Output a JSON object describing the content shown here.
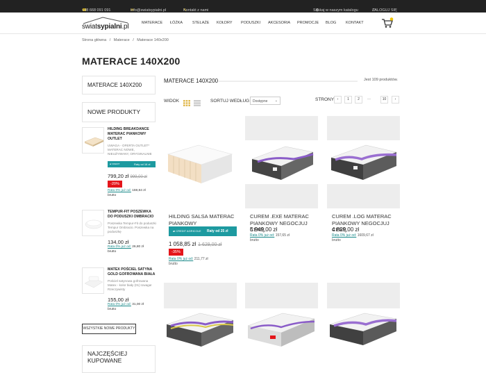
{
  "topbar": {
    "phone": "+48 668 091 091",
    "email": "info@swiatsypialni.pl",
    "contact": "Kontakt z nami",
    "search": "Szukaj w naszym katalogu",
    "login": "ZALOGUJ SIĘ"
  },
  "logo": {
    "part1": "swiat",
    "part2": "sypialni",
    "part3": ".pl"
  },
  "nav": [
    "MATERACE",
    "ŁÓŻKA",
    "STELAŻE",
    "KOŁDRY",
    "PODUSZKI",
    "AKCESORIA",
    "PROMOCJE",
    "BLOG",
    "KONTAKT"
  ],
  "breadcrumb": {
    "home": "Strona główna",
    "cat": "Materace",
    "current": "Materace 140x200",
    "sep": "/"
  },
  "page_title": "MATERACE 140X200",
  "sidebar": {
    "category_title": "MATERACE 140X200",
    "new_title": "NOWE PRODUKTY",
    "new_products": [
      {
        "name": "HILDING BREAKDANCE MATERAC PIANKOWY OUTLET",
        "desc": "UWAGA - OFERTA OUTLET* MATERAC NOWE, NIEUŻYWANY, ORYGINALNIE",
        "price": "799,20 zł",
        "old_price": "999,00 zł",
        "badge": "-20%",
        "banner": "Raty od 16 zł",
        "rata_link": "Rata 0% już od:",
        "rata_value": "159,84 zł",
        "rata_suffix": "brutto"
      },
      {
        "name": "TEMPUR-FIT POSZEWKA DO PODUSZKI OMBRACIO",
        "desc": "Poszewka Tempur-Fit do poduszki Tempur Ombracio. Poszewka na poduszkę",
        "price": "134,00 zł",
        "rata_link": "Rata 0% już od:",
        "rata_value": "26,80 zł",
        "rata_suffix": "brutto"
      },
      {
        "name": "MATEX POŚCIEL SATYNA GOLD GOFROWANA BIAŁA",
        "desc": "Pościel satynowa gofrowana Matex - kolor biały (01) Uwaga! Rzeczywisty",
        "price": "155,00 zł",
        "rata_link": "Rata 0% już od:",
        "rata_value": "31,00 zł",
        "rata_suffix": "brutto"
      }
    ],
    "all_new_button": "WSZYSTKIE NOWE PRODUKTY",
    "coupons_title": "NAJCZĘŚCIEJ KUPOWANE"
  },
  "main": {
    "title": "MATERACE 140X200",
    "count": "Jest 109 produktów.",
    "view_label": "WIDOK",
    "sort_label": "SORTUJ WEDŁUG",
    "sort_value": "Dostępne",
    "pages_label": "STRONY",
    "pages": [
      "‹",
      "1",
      "2",
      "…",
      "10",
      "›"
    ]
  },
  "products": [
    {
      "name": "HILDING SALSA MATERAC PIANKOWY",
      "price": "1 058,85 zł",
      "old_price": "1 629,00 zł",
      "badge": "-35%",
      "banner": "Raty od 25 zł",
      "rata_link": "Rata 0% już od:",
      "rata_value": "211,77 zł",
      "rata_suffix": "brutto"
    },
    {
      "name": "CUREM .EXE MATERAC PIANKOWY NEGOCJUJ CENĘ",
      "price": "5 949,00 zł",
      "rata_link": "Rata 0% już od:",
      "rata_value": "157,65 zł",
      "rata_suffix": "brutto"
    },
    {
      "name": "CUREM .LOG MATERAC PIANKOWY NEGOCJUJ CENĘ",
      "price": "4 829,00 zł",
      "rata_link": "Rata 0% już od:",
      "rata_value": "1609,67 zł",
      "rata_suffix": "brutto"
    }
  ],
  "colors": {
    "accent_teal": "#1d9aa0",
    "badge_red": "#e4161b",
    "topbar": "#222222",
    "icon_yellow": "#f0c400"
  },
  "icons": [
    "phone-icon",
    "mail-icon",
    "pencil-icon",
    "search-icon",
    "user-icon",
    "cart-icon",
    "grid-view-icon",
    "list-view-icon"
  ]
}
